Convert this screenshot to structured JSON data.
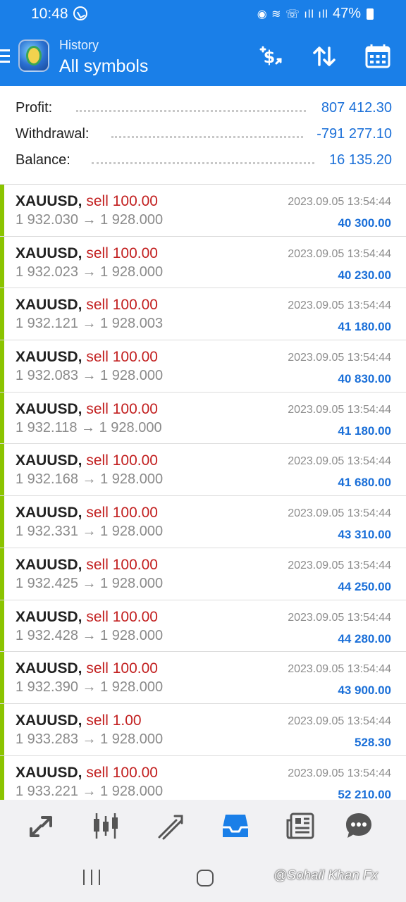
{
  "status_bar": {
    "time": "10:48",
    "battery": "47%"
  },
  "app_bar": {
    "subtitle": "History",
    "title": "All symbols"
  },
  "summary": {
    "profit_label": "Profit:",
    "profit_value": "807 412.30",
    "withdrawal_label": "Withdrawal:",
    "withdrawal_value": "-791 277.10",
    "balance_label": "Balance:",
    "balance_value": "16 135.20"
  },
  "trades": [
    {
      "symbol": "XAUUSD,",
      "side": "sell 100.00",
      "date": "2023.09.05 13:54:44",
      "prices": "1 932.030 → 1 928.000",
      "profit": "40 300.00"
    },
    {
      "symbol": "XAUUSD,",
      "side": "sell 100.00",
      "date": "2023.09.05 13:54:44",
      "prices": "1 932.023 → 1 928.000",
      "profit": "40 230.00"
    },
    {
      "symbol": "XAUUSD,",
      "side": "sell 100.00",
      "date": "2023.09.05 13:54:44",
      "prices": "1 932.121 → 1 928.003",
      "profit": "41 180.00"
    },
    {
      "symbol": "XAUUSD,",
      "side": "sell 100.00",
      "date": "2023.09.05 13:54:44",
      "prices": "1 932.083 → 1 928.000",
      "profit": "40 830.00"
    },
    {
      "symbol": "XAUUSD,",
      "side": "sell 100.00",
      "date": "2023.09.05 13:54:44",
      "prices": "1 932.118 → 1 928.000",
      "profit": "41 180.00"
    },
    {
      "symbol": "XAUUSD,",
      "side": "sell 100.00",
      "date": "2023.09.05 13:54:44",
      "prices": "1 932.168 → 1 928.000",
      "profit": "41 680.00"
    },
    {
      "symbol": "XAUUSD,",
      "side": "sell 100.00",
      "date": "2023.09.05 13:54:44",
      "prices": "1 932.331 → 1 928.000",
      "profit": "43 310.00"
    },
    {
      "symbol": "XAUUSD,",
      "side": "sell 100.00",
      "date": "2023.09.05 13:54:44",
      "prices": "1 932.425 → 1 928.000",
      "profit": "44 250.00"
    },
    {
      "symbol": "XAUUSD,",
      "side": "sell 100.00",
      "date": "2023.09.05 13:54:44",
      "prices": "1 932.428 → 1 928.000",
      "profit": "44 280.00"
    },
    {
      "symbol": "XAUUSD,",
      "side": "sell 100.00",
      "date": "2023.09.05 13:54:44",
      "prices": "1 932.390 → 1 928.000",
      "profit": "43 900.00"
    },
    {
      "symbol": "XAUUSD,",
      "side": "sell 1.00",
      "date": "2023.09.05 13:54:44",
      "prices": "1 933.283 → 1 928.000",
      "profit": "528.30"
    },
    {
      "symbol": "XAUUSD,",
      "side": "sell 100.00",
      "date": "2023.09.05 13:54:44",
      "prices": "1 933.221 → 1 928.000",
      "profit": "52 210.00"
    }
  ],
  "bottom_nav": {
    "items": [
      {
        "icon": "quotes-icon",
        "active": false
      },
      {
        "icon": "chart-icon",
        "active": false
      },
      {
        "icon": "trade-icon",
        "active": false
      },
      {
        "icon": "history-icon",
        "active": true
      },
      {
        "icon": "news-icon",
        "active": false
      },
      {
        "icon": "messages-icon",
        "active": false
      }
    ]
  },
  "watermark": "@Sohail Khan Fx",
  "colors": {
    "accent": "#1a7fe8",
    "sell": "#c21f1f",
    "profit": "#1a6fd8",
    "row_marker": "#8bc400"
  }
}
